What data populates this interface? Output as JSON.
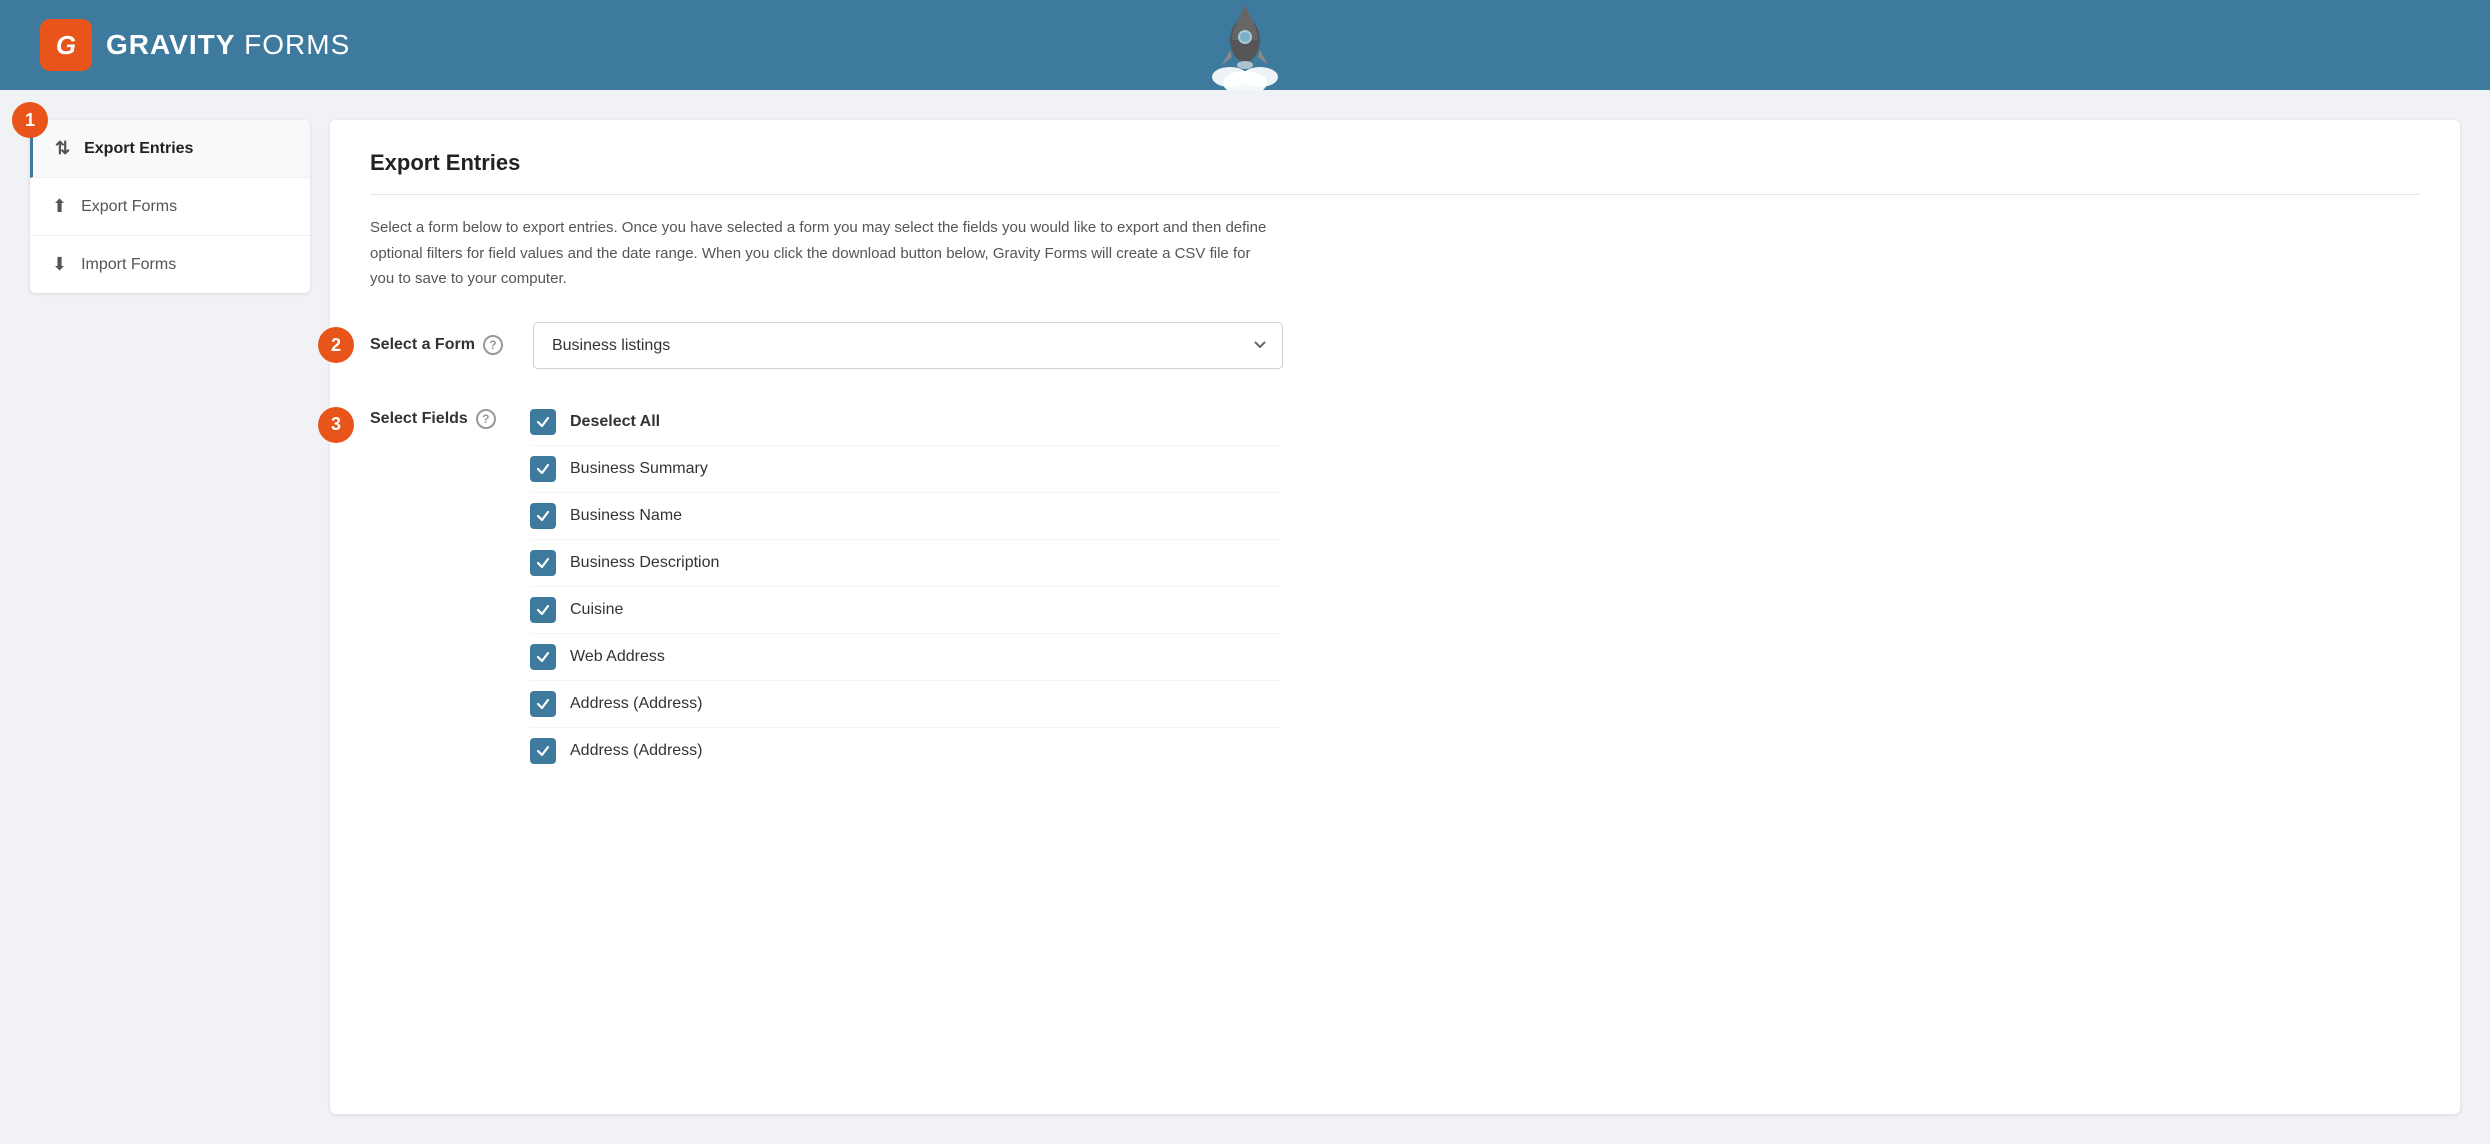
{
  "header": {
    "logo_letter": "G",
    "logo_bold": "GRAVITY",
    "logo_light": " FORMS"
  },
  "sidebar": {
    "step1_badge": "1",
    "items": [
      {
        "id": "export-entries",
        "label": "Export Entries",
        "icon": "⇅",
        "active": true
      },
      {
        "id": "export-forms",
        "label": "Export Forms",
        "icon": "⬆",
        "active": false
      },
      {
        "id": "import-forms",
        "label": "Import Forms",
        "icon": "⬇",
        "active": false
      }
    ]
  },
  "content": {
    "title": "Export Entries",
    "description": "Select a form below to export entries. Once you have selected a form you may select the fields you would like to export and then define optional filters for field values and the date range. When you click the download button below, Gravity Forms will create a CSV file for you to save to your computer.",
    "step2_badge": "2",
    "step3_badge": "3",
    "select_form_label": "Select a Form",
    "select_form_help": "?",
    "select_form_value": "Business listings",
    "select_fields_label": "Select Fields",
    "select_fields_help": "?",
    "fields": [
      {
        "label": "Deselect All",
        "bold": true,
        "checked": true
      },
      {
        "label": "Business Summary",
        "bold": false,
        "checked": true
      },
      {
        "label": "Business Name",
        "bold": false,
        "checked": true
      },
      {
        "label": "Business Description",
        "bold": false,
        "checked": true
      },
      {
        "label": "Cuisine",
        "bold": false,
        "checked": true
      },
      {
        "label": "Web Address",
        "bold": false,
        "checked": true
      },
      {
        "label": "Address (Address)",
        "bold": false,
        "checked": true
      },
      {
        "label": "Address (Address)",
        "bold": false,
        "checked": true
      }
    ]
  }
}
